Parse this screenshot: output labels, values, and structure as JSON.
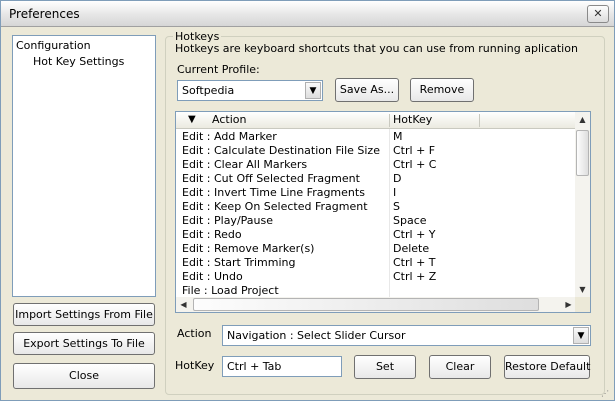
{
  "window": {
    "title": "Preferences",
    "close_glyph": "✕",
    "close_icon": "close-icon"
  },
  "sidebar": {
    "items": [
      {
        "label": "Configuration"
      },
      {
        "label": "Hot Key Settings"
      }
    ]
  },
  "left_buttons": {
    "import_label": "Import Settings From File",
    "export_label": "Export Settings To File",
    "close_label": "Close"
  },
  "hotkeys": {
    "group_title": "Hotkeys",
    "description": "Hotkeys are keyboard shortcuts that you can use from running aplication",
    "current_profile_label": "Current Profile:",
    "profile_value": "Softpedia",
    "save_as_label": "Save As...",
    "remove_label": "Remove",
    "table": {
      "sort_glyph": "▼",
      "columns": [
        "Action",
        "HotKey"
      ],
      "rows": [
        {
          "action": "Edit : Add Marker",
          "hotkey": "M"
        },
        {
          "action": "Edit : Calculate Destination File Size",
          "hotkey": "Ctrl + F"
        },
        {
          "action": "Edit : Clear All Markers",
          "hotkey": "Ctrl + C"
        },
        {
          "action": "Edit : Cut Off Selected Fragment",
          "hotkey": "D"
        },
        {
          "action": "Edit : Invert Time Line Fragments",
          "hotkey": "I"
        },
        {
          "action": "Edit : Keep On Selected Fragment",
          "hotkey": "S"
        },
        {
          "action": "Edit : Play/Pause",
          "hotkey": "Space"
        },
        {
          "action": "Edit : Redo",
          "hotkey": "Ctrl + Y"
        },
        {
          "action": "Edit : Remove Marker(s)",
          "hotkey": "Delete"
        },
        {
          "action": "Edit : Start Trimming",
          "hotkey": "Ctrl + T"
        },
        {
          "action": "Edit : Undo",
          "hotkey": "Ctrl + Z"
        },
        {
          "action": "File : Load Project",
          "hotkey": ""
        }
      ]
    },
    "action_label": "Action",
    "action_value": "Navigation : Select Slider Cursor",
    "hotkey_label": "HotKey",
    "hotkey_value": "Ctrl + Tab",
    "set_label": "Set",
    "clear_label": "Clear",
    "restore_label": "Restore Default"
  },
  "glyphs": {
    "dropdown_arrow": "▼",
    "scroll_up": "▲",
    "scroll_down": "▼",
    "scroll_left": "◀",
    "scroll_right": "▶"
  }
}
